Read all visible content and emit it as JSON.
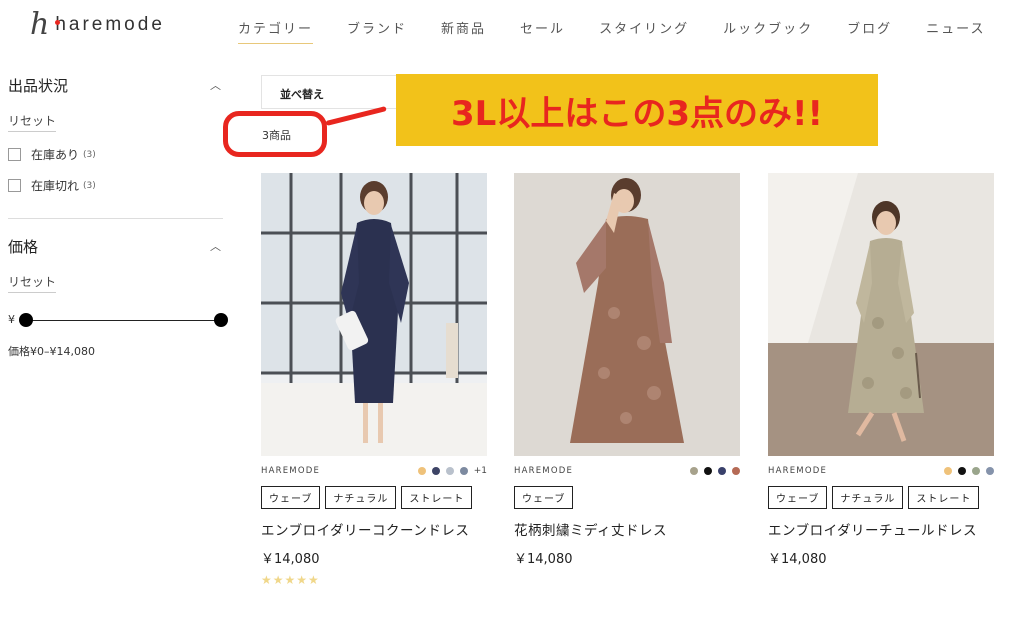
{
  "header": {
    "logo_mark": "h",
    "logo_text": "haremode",
    "nav": [
      "カテゴリー",
      "ブランド",
      "新商品",
      "セール",
      "スタイリング",
      "ルックブック",
      "ブログ",
      "ニュース"
    ]
  },
  "sidebar": {
    "stock_facet": {
      "title": "出品状況",
      "reset": "リセット",
      "options": [
        {
          "label": "在庫あり",
          "count": "(3)"
        },
        {
          "label": "在庫切れ",
          "count": "(3)"
        }
      ]
    },
    "price_facet": {
      "title": "価格",
      "reset": "リセット",
      "currency": "¥",
      "range_text": "価格¥0–¥14,080"
    }
  },
  "toolbar": {
    "sort_label": "並べ替え",
    "result_count": "3商品"
  },
  "annotation": {
    "callout": "3L以上はこの3点のみ!!"
  },
  "colors": {
    "accent_gold": "#e8c87a",
    "annotation_red": "#e8261f",
    "callout_yellow": "#f2c21a",
    "star": "#f0d78a"
  },
  "products": [
    {
      "brand": "HAREMODE",
      "name": "エンブロイダリーコクーンドレス",
      "price": "￥14,080",
      "tags": [
        "ウェーブ",
        "ナチュラル",
        "ストレート"
      ],
      "swatches": [
        "#efc27a",
        "#3d4466",
        "#b9c1cc",
        "#7d8aa0"
      ],
      "more_colors": "+1",
      "rating": "★★★★★",
      "rating_value": 0
    },
    {
      "brand": "HAREMODE",
      "name": "花柄刺繍ミディ丈ドレス",
      "price": "￥14,080",
      "tags": [
        "ウェーブ"
      ],
      "swatches": [
        "#a7a28c",
        "#111111",
        "#39406b",
        "#b56a55"
      ],
      "more_colors": "",
      "rating": "",
      "rating_value": null
    },
    {
      "brand": "HAREMODE",
      "name": "エンブロイダリーチュールドレス",
      "price": "￥14,080",
      "tags": [
        "ウェーブ",
        "ナチュラル",
        "ストレート"
      ],
      "swatches": [
        "#efc27a",
        "#111111",
        "#9aa58c",
        "#8593ab"
      ],
      "more_colors": "",
      "rating": "",
      "rating_value": null
    }
  ]
}
